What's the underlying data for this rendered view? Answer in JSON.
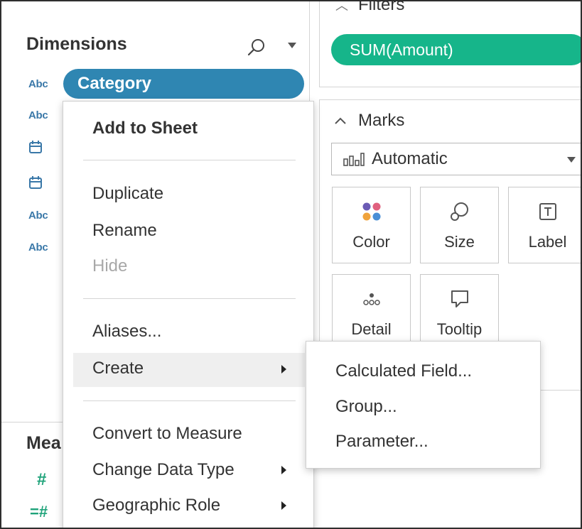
{
  "data_pane": {
    "dimensions_header": "Dimensions",
    "field_types": [
      "Abc",
      "Abc",
      "calendar",
      "calendar",
      "Abc",
      "Abc"
    ],
    "selected_field": "Category",
    "measures_header": "Mea"
  },
  "filters": {
    "title": "Filters",
    "pill": "SUM(Amount)"
  },
  "marks": {
    "title": "Marks",
    "mark_type": "Automatic",
    "buttons": [
      {
        "label": "Color",
        "icon": "color-dots-icon"
      },
      {
        "label": "Size",
        "icon": "size-icon"
      },
      {
        "label": "Label",
        "icon": "label-icon"
      },
      {
        "label": "Detail",
        "icon": "detail-icon"
      },
      {
        "label": "Tooltip",
        "icon": "tooltip-icon"
      }
    ]
  },
  "context_menu": {
    "add_to_sheet": "Add to Sheet",
    "duplicate": "Duplicate",
    "rename": "Rename",
    "hide": "Hide",
    "aliases": "Aliases...",
    "create": "Create",
    "convert_to_measure": "Convert to Measure",
    "change_data_type": "Change Data Type",
    "geographic_role": "Geographic Role"
  },
  "create_submenu": {
    "calculated_field": "Calculated Field...",
    "group": "Group...",
    "parameter": "Parameter..."
  },
  "colors": {
    "dimension_pill": "#2f86b2",
    "measure_pill": "#16b58a",
    "abc_text": "#3a78a8",
    "measure_hash": "#1fa37a"
  }
}
